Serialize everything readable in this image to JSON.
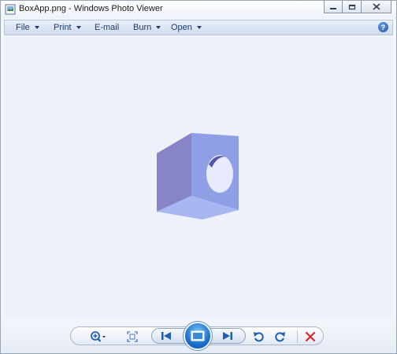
{
  "window": {
    "title": "BoxApp.png - Windows Photo Viewer"
  },
  "menu": {
    "items": [
      {
        "label": "File",
        "has_dropdown": true
      },
      {
        "label": "Print",
        "has_dropdown": true
      },
      {
        "label": "E-mail",
        "has_dropdown": false
      },
      {
        "label": "Burn",
        "has_dropdown": true
      },
      {
        "label": "Open",
        "has_dropdown": true
      }
    ],
    "help_label": "?"
  },
  "photo": {
    "description_icon": "3d-box-with-hole",
    "colors": {
      "front": "#8c86c9",
      "right": "#8e9ee6",
      "top": "#a6b4f0",
      "hole": "#e9ecfb"
    }
  },
  "controls": {
    "icons": [
      "zoom-icon",
      "actual-size-icon",
      "previous-icon",
      "slideshow-icon",
      "next-icon",
      "rotate-counterclockwise-icon",
      "rotate-clockwise-icon",
      "delete-icon"
    ]
  },
  "colors": {
    "accent": "#1b6fcc",
    "viewer_bg": "#eef1f9",
    "delete": "#d22a2a"
  }
}
